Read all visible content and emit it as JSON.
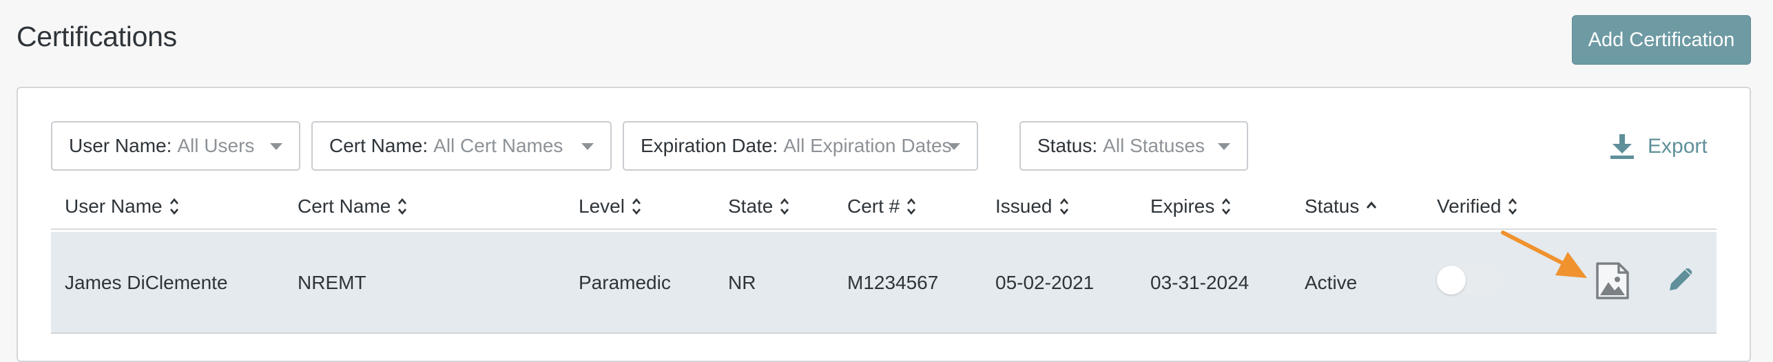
{
  "page": {
    "title": "Certifications"
  },
  "header": {
    "add_button": "Add Certification"
  },
  "filters": [
    {
      "label": "User Name:",
      "value": "All Users"
    },
    {
      "label": "Cert Name:",
      "value": "All Cert Names"
    },
    {
      "label": "Expiration Date:",
      "value": "All Expiration Dates"
    },
    {
      "label": "Status:",
      "value": "All Statuses"
    }
  ],
  "export": {
    "label": "Export",
    "icon": "download-icon"
  },
  "table": {
    "columns": [
      "User Name",
      "Cert Name",
      "Level",
      "State",
      "Cert #",
      "Issued",
      "Expires",
      "Status",
      "Verified"
    ],
    "sort": {
      "column": "Status",
      "direction": "ascending"
    },
    "rows": [
      {
        "user_name": "James DiClemente",
        "cert_name": "NREMT",
        "level": "Paramedic",
        "state": "NR",
        "cert_number": "M1234567",
        "issued": "05-02-2021",
        "expires": "03-31-2024",
        "status": "Active",
        "verified": false,
        "actions": [
          "image-icon",
          "pencil-icon"
        ]
      }
    ]
  },
  "colors": {
    "accent": "#6e9aa3",
    "link": "#5e8f9a",
    "row_highlight": "#e4eaee",
    "annotation_arrow": "#f0922e"
  }
}
